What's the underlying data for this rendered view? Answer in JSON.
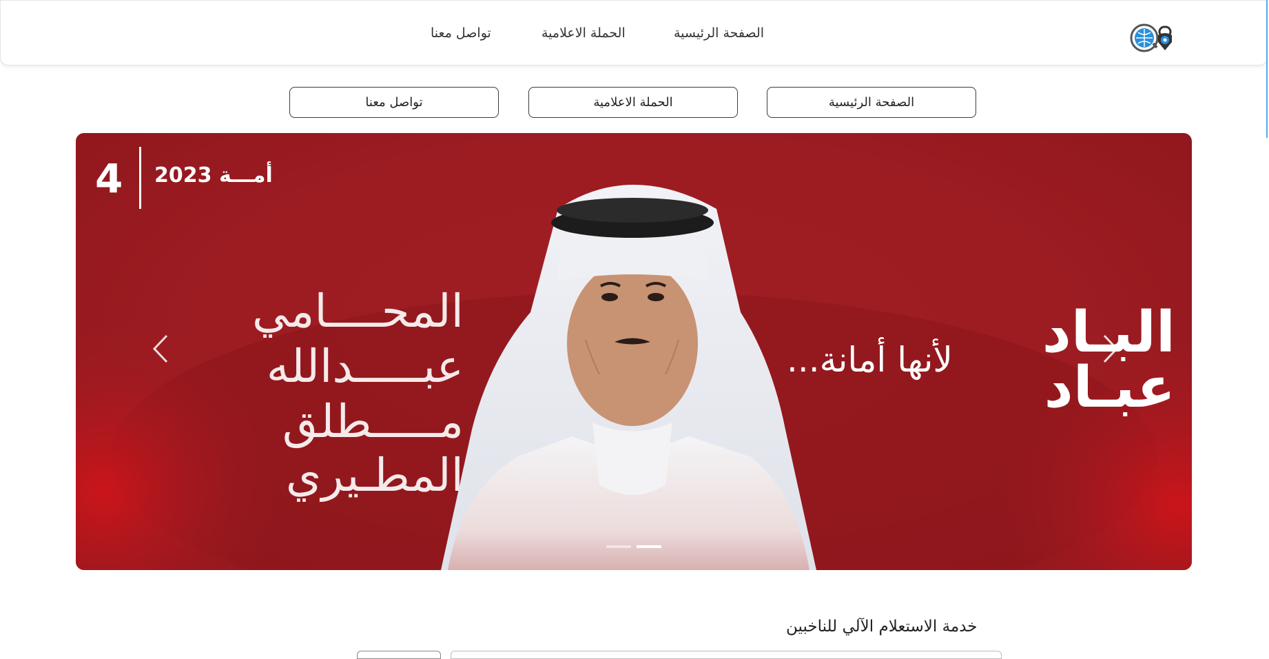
{
  "nav": {
    "home": "الصفحة الرئيسية",
    "campaign": "الحملة الاعلامية",
    "contact": "تواصل معنا"
  },
  "buttons": {
    "home": "الصفحة الرئيسية",
    "campaign": "الحملة الاعلامية",
    "contact": "تواصل معنا"
  },
  "hero": {
    "district_number": "4",
    "badge_text": "أمـــة 2023",
    "name_lines": [
      "المحــــامي",
      "عبـــــدالله",
      "مـــــطلق",
      "المطـيري"
    ],
    "tagline": "لأنها أمانة...",
    "slogan": "البـاد عبـاد",
    "slides_total": 2,
    "active_slide": 2
  },
  "section": {
    "title": "خدمة الاستعلام الآلي للناخبين"
  },
  "colors": {
    "hero_red": "#9c1c22",
    "accent_blue": "#1e88d6"
  }
}
